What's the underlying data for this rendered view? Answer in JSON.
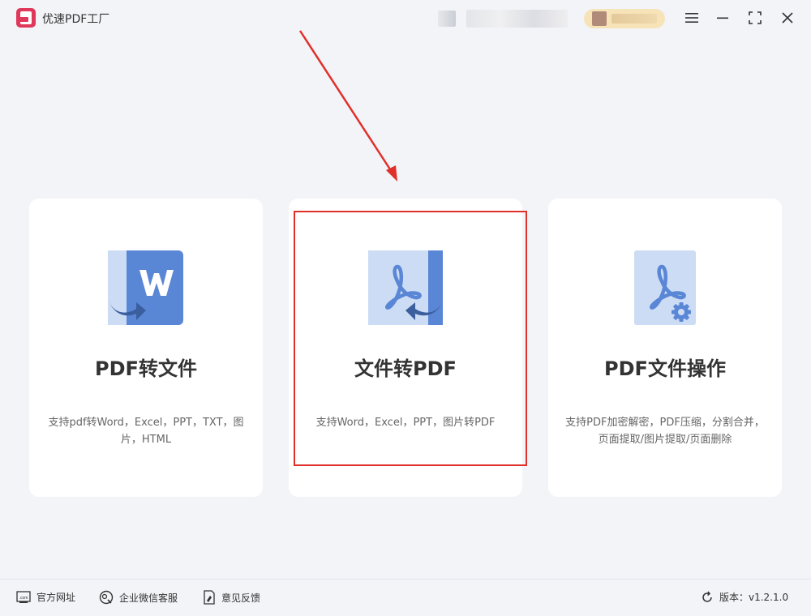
{
  "app": {
    "title": "优速PDF工厂"
  },
  "cards": [
    {
      "title": "PDF转文件",
      "desc": "支持pdf转Word，Excel，PPT，TXT，图片，HTML",
      "icon": "pdf-to-word-icon"
    },
    {
      "title": "文件转PDF",
      "desc": "支持Word，Excel，PPT，图片转PDF",
      "icon": "file-to-pdf-icon"
    },
    {
      "title": "PDF文件操作",
      "desc": "支持PDF加密解密，PDF压缩，分割合并，页面提取/图片提取/页面删除",
      "icon": "pdf-settings-icon"
    }
  ],
  "footer": {
    "website": "官方网址",
    "wechat": "企业微信客服",
    "feedback": "意见反馈",
    "version": "版本：v1.2.1.0"
  },
  "colors": {
    "accent_blue": "#5a86d6",
    "light_blue": "#ccdcf4",
    "logo_red": "#e0385a",
    "highlight_red": "#e0302a"
  }
}
